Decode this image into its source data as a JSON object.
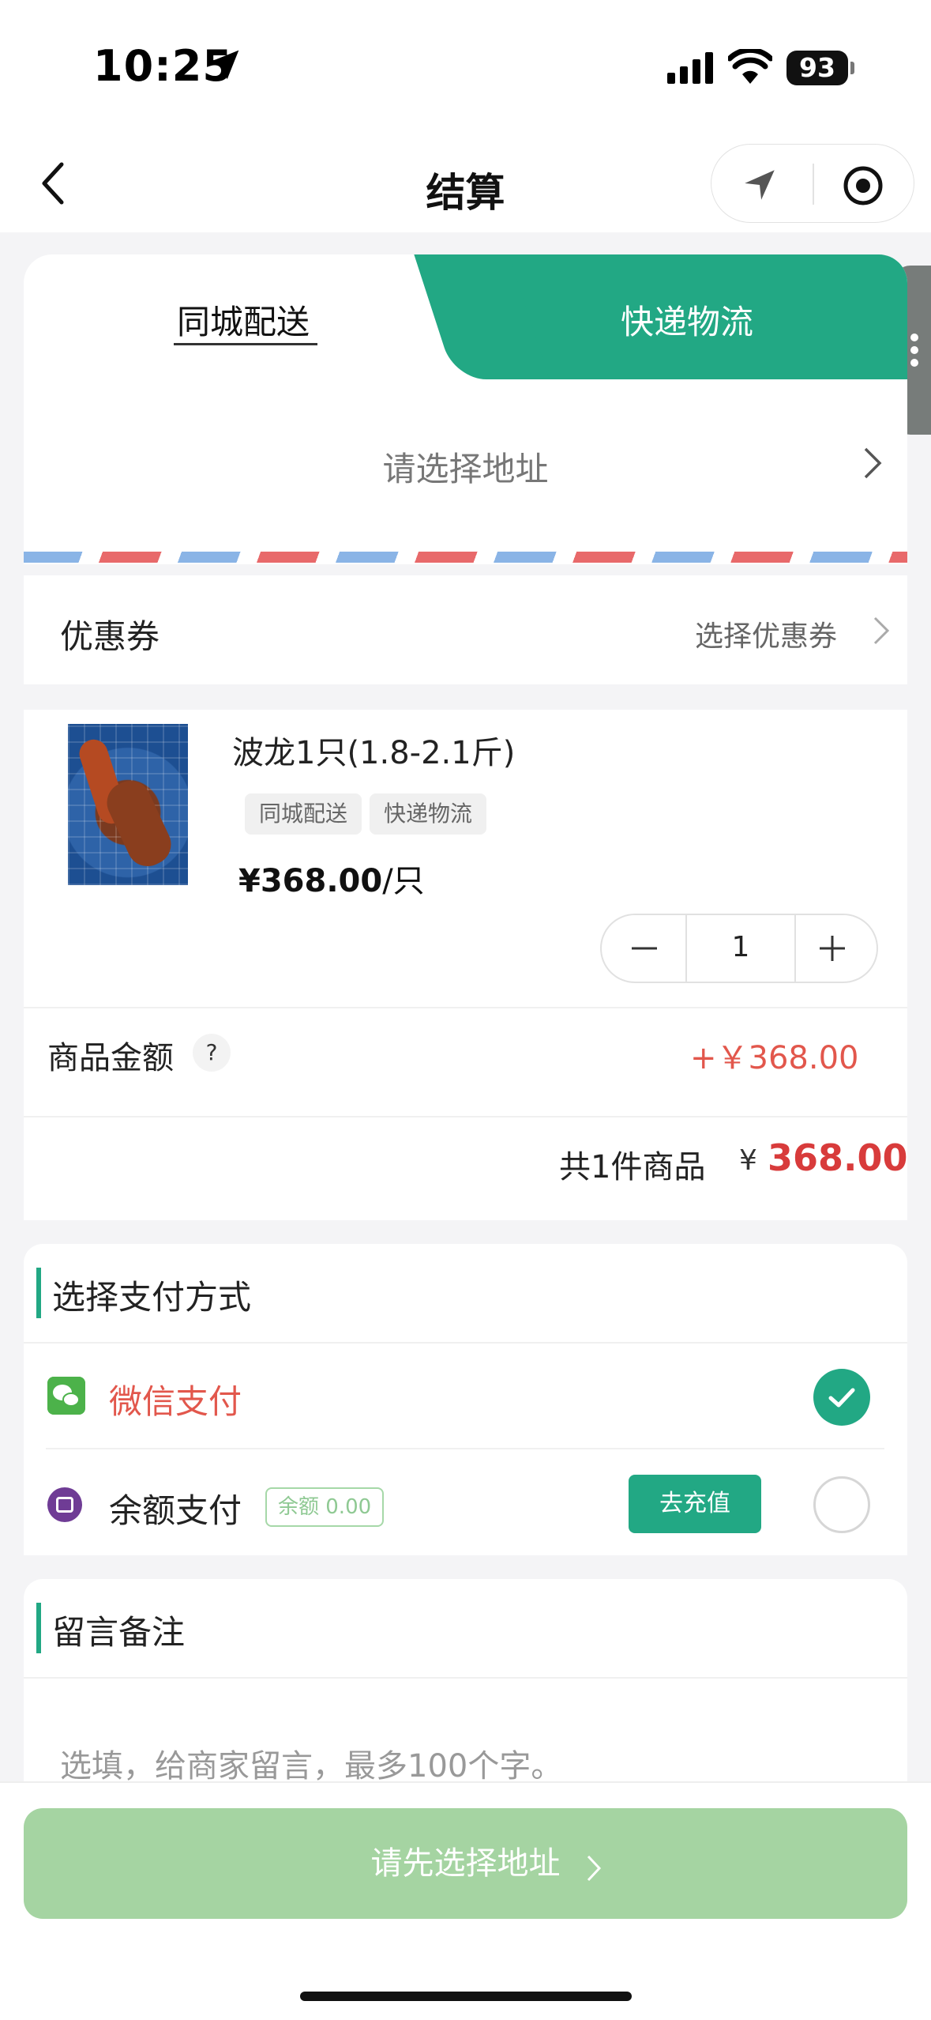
{
  "status_bar": {
    "time": "10:25",
    "battery": "93"
  },
  "nav": {
    "title": "结算"
  },
  "delivery": {
    "tab_local": "同城配送",
    "tab_express": "快递物流",
    "address_placeholder": "请选择地址"
  },
  "coupon": {
    "label": "优惠券",
    "value": "选择优惠券"
  },
  "product": {
    "name": "波龙1只(1.8-2.1斤)",
    "tags": [
      "同城配送",
      "快递物流"
    ],
    "price_symbol": "¥",
    "price": "368.00",
    "unit": "/只",
    "quantity": "1",
    "amount_label": "商品金额",
    "help": "?",
    "amount_value": "+￥368.00",
    "total_label": "共1件商品",
    "total_symbol": "¥",
    "total_value": "368.00"
  },
  "payment": {
    "title": "选择支付方式",
    "wechat": "微信支付",
    "balance": "余额支付",
    "balance_tag": "余额 0.00",
    "recharge": "去充值"
  },
  "remark": {
    "title": "留言备注",
    "placeholder": "选填，给商家留言，最多100个字。"
  },
  "submit": {
    "label": "请先选择地址"
  },
  "colors": {
    "accent": "#22a884",
    "price_red": "#d83b3b",
    "submit_disabled": "#a5d4a2"
  }
}
